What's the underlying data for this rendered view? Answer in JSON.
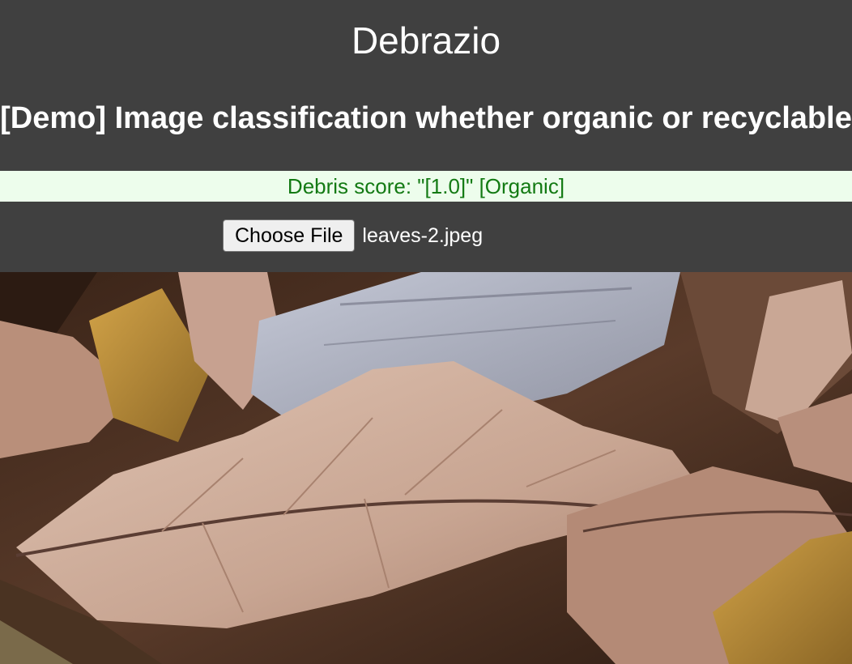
{
  "header": {
    "title": "Debrazio",
    "subtitle": "[Demo] Image classification whether organic or recyclable"
  },
  "result": {
    "text": "Debris score: \"[1.0]\" [Organic]"
  },
  "upload": {
    "button_label": "Choose File",
    "file_name": "leaves-2.jpeg"
  },
  "preview": {
    "icon": "leaves-photo",
    "palette": {
      "dark": "#2c1b12",
      "brown": "#8f6954",
      "tan": "#d8b8a7",
      "leaf": "#c9a795",
      "gray": "#b2b6c4",
      "gold": "#b98c38",
      "vein": "#5a3d33"
    }
  },
  "colors": {
    "background": "#404040",
    "result_bg": "#edfdec",
    "result_text": "#137a13"
  }
}
